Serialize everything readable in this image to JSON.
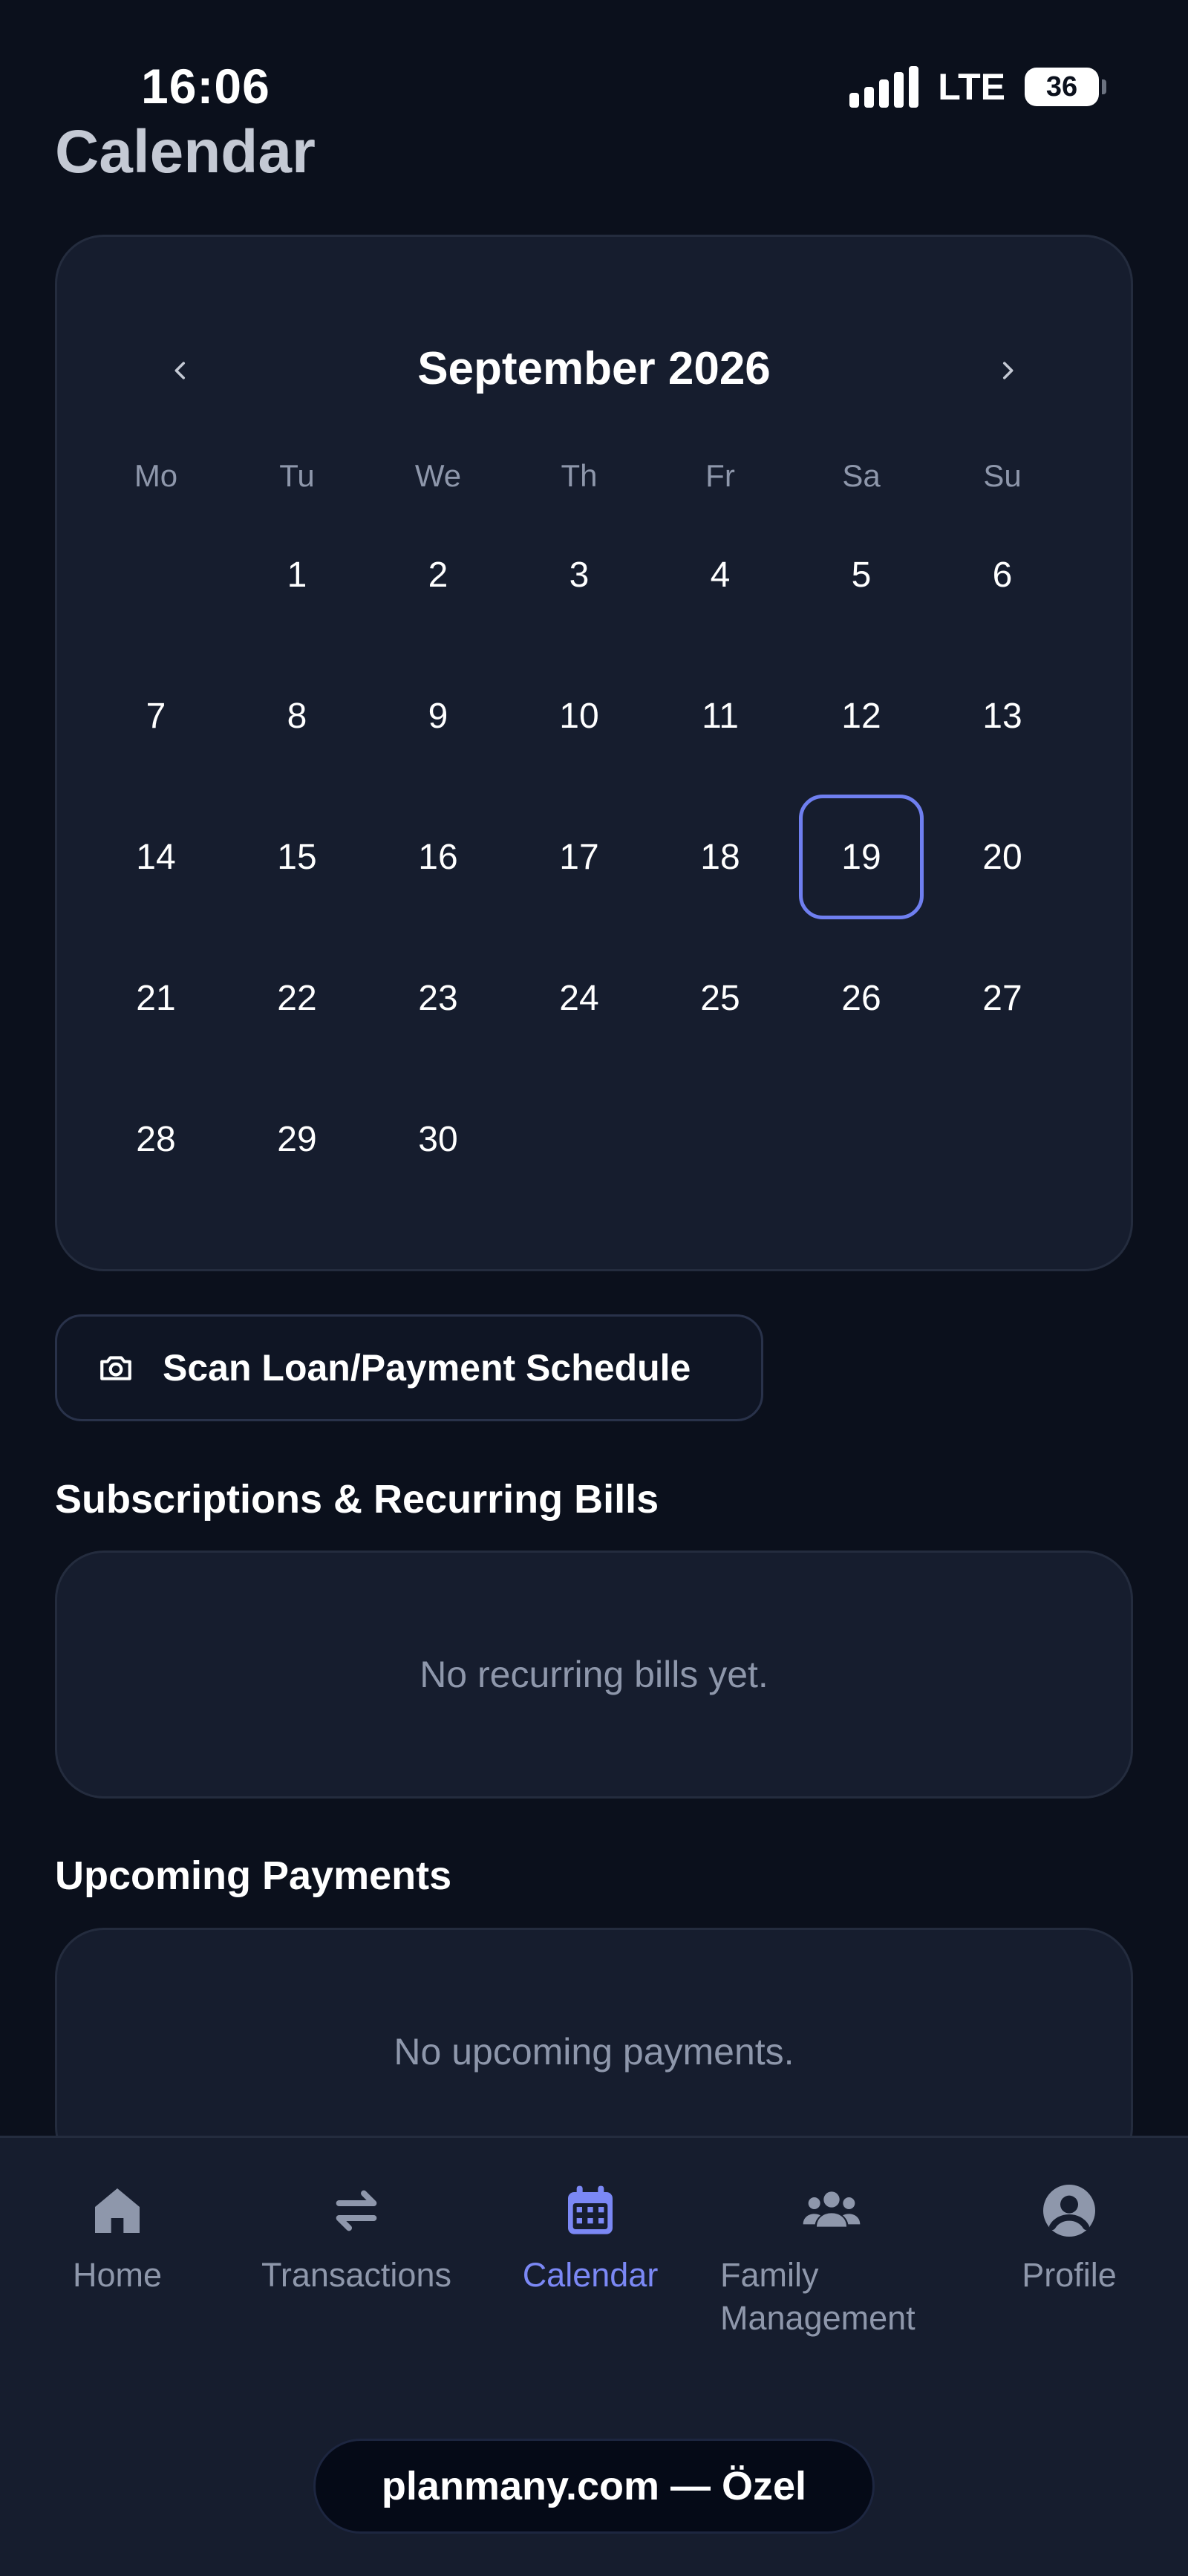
{
  "status_bar": {
    "time": "16:06",
    "network": "LTE",
    "battery": "36"
  },
  "page": {
    "title": "Calendar"
  },
  "calendar": {
    "month_label": "September 2026",
    "weekdays": [
      "Mo",
      "Tu",
      "We",
      "Th",
      "Fr",
      "Sa",
      "Su"
    ],
    "leading_blanks": 1,
    "days": [
      "1",
      "2",
      "3",
      "4",
      "5",
      "6",
      "7",
      "8",
      "9",
      "10",
      "11",
      "12",
      "13",
      "14",
      "15",
      "16",
      "17",
      "18",
      "19",
      "20",
      "21",
      "22",
      "23",
      "24",
      "25",
      "26",
      "27",
      "28",
      "29",
      "30"
    ],
    "selected_day": "19",
    "accent_color": "#6f7ff0"
  },
  "scan_button": {
    "label": "Scan Loan/Payment Schedule",
    "icon": "camera-icon"
  },
  "recurring": {
    "title": "Subscriptions & Recurring Bills",
    "empty_message": "No recurring bills yet."
  },
  "upcoming": {
    "title": "Upcoming Payments",
    "empty_message": "No upcoming payments."
  },
  "bottom_nav": {
    "items": [
      {
        "label": "Home",
        "icon": "home-icon",
        "active": false
      },
      {
        "label": "Transactions",
        "icon": "arrows-exchange-icon",
        "active": false
      },
      {
        "label": "Calendar",
        "icon": "calendar-icon",
        "active": true
      },
      {
        "label": "Family Management",
        "icon": "users-group-icon",
        "active": false
      },
      {
        "label": "Profile",
        "icon": "user-circle-icon",
        "active": false
      }
    ],
    "active_color": "#7b88f5"
  },
  "url_bar": {
    "text": "planmany.com — Özel"
  }
}
